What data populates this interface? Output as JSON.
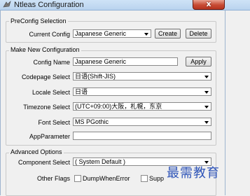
{
  "window": {
    "title": "Ntleas Configuration",
    "close_label": "x"
  },
  "preconfig": {
    "group_label": "PreConfig Selection",
    "current_label": "Current Config",
    "current_value": "Japanese Generic",
    "create_label": "Create",
    "delete_label": "Delete"
  },
  "new_config": {
    "group_label": "Make New Configuration",
    "name_label": "Config Name",
    "name_value": "Japanese Generic",
    "apply_label": "Apply",
    "codepage_label": "Codepage Select",
    "codepage_value": "日语(Shift-JIS)",
    "locale_label": "Locale Select",
    "locale_value": "日语",
    "timezone_label": "Timezone Select",
    "timezone_value": "(UTC+09:00)大阪，札幌，东京",
    "font_label": "Font Select",
    "font_value": "MS PGothic",
    "appparam_label": "AppParameter",
    "appparam_value": ""
  },
  "advanced": {
    "group_label": "Advanced Options",
    "component_label": "Component Select",
    "component_value": "( System Default )",
    "flags_label": "Other Flags",
    "flag1_label": "DumpWhenError",
    "flag2_label": "Supp"
  },
  "watermark": "最需教育",
  "colors": {
    "watermark": "#2f55b8",
    "close": "#c74a33"
  }
}
